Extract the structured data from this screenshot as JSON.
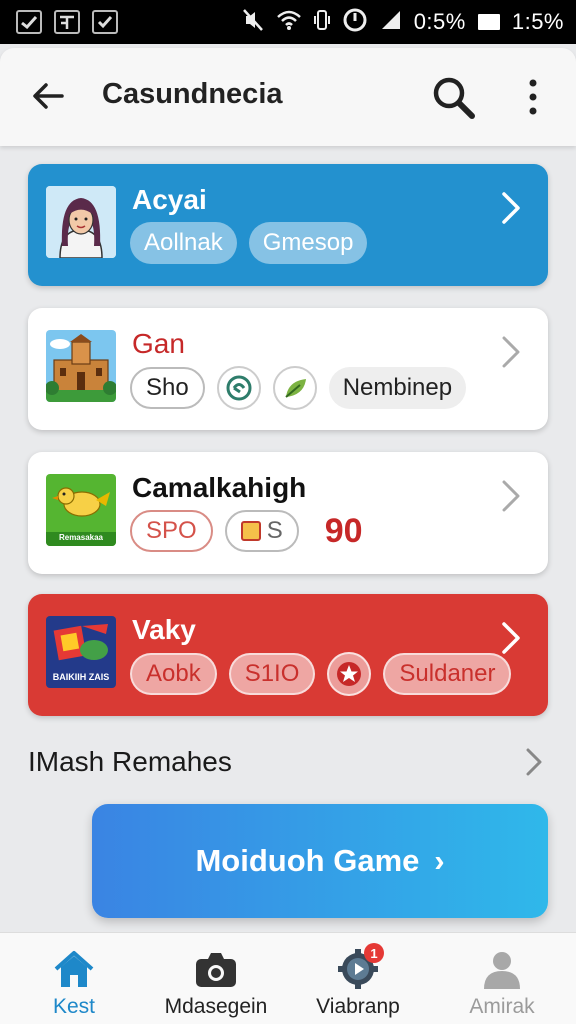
{
  "status_bar": {
    "left_icons": [
      "check-box-icon",
      "plus-box-icon",
      "checkbox-icon"
    ],
    "signal_text": "0:5%",
    "time": "1:5%"
  },
  "app_bar": {
    "title": "Casundnecia"
  },
  "cards": [
    {
      "title": "Acyai",
      "style": "blue",
      "chips": [
        {
          "label": "Aollnak"
        },
        {
          "label": "Gmesop"
        }
      ]
    },
    {
      "title": "Gan",
      "title_color": "#c62828",
      "style": "white",
      "chips": [
        {
          "label": "Sho"
        },
        {
          "label": "Nembinep"
        }
      ]
    },
    {
      "title": "Camalkahigh",
      "title_color": "#111111",
      "style": "white",
      "chips": [
        {
          "label": "SPO"
        },
        {
          "label": "S"
        }
      ],
      "number": "90",
      "thumb_text": "Remasakaa"
    },
    {
      "title": "Vaky",
      "style": "red",
      "chips": [
        {
          "label": "Aobk"
        },
        {
          "label": "S1IO"
        },
        {
          "label": "Suldaner"
        }
      ],
      "thumb_text": "BAIKIIH ZAIS"
    }
  ],
  "section": {
    "title": "IMash Remahes"
  },
  "cta": {
    "label": "Moiduoh Game  ›"
  },
  "bottom_nav": {
    "items": [
      {
        "label": "Kest",
        "icon": "home-icon",
        "state": "active"
      },
      {
        "label": "Mdasegein",
        "icon": "camera-icon",
        "state": "normal"
      },
      {
        "label": "Viabranp",
        "icon": "gear-play-icon",
        "state": "normal",
        "badge": "1"
      },
      {
        "label": "Amirak",
        "icon": "person-icon",
        "state": "dim"
      }
    ]
  },
  "colors": {
    "accent_blue": "#2391cf",
    "accent_red": "#d93a34",
    "nav_active": "#1e88c9",
    "number_red": "#c62828"
  }
}
